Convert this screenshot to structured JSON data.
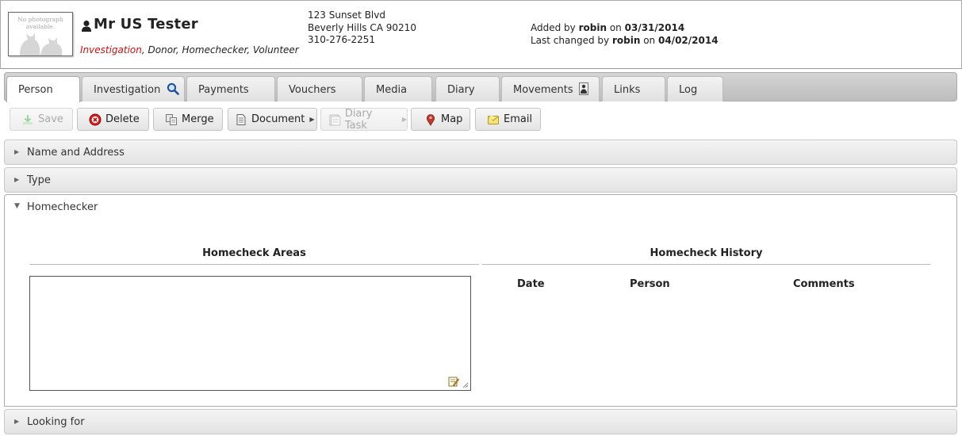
{
  "header": {
    "photo_text": "No photograph available.",
    "name": "Mr US Tester",
    "flags": {
      "warning": "Investigation",
      "rest": ", Donor, Homechecker, Volunteer"
    },
    "address": {
      "line1": "123 Sunset Blvd",
      "line2": "Beverly Hills CA 90210",
      "phone": "310-276-2251"
    },
    "audit": {
      "added_prefix": "Added by",
      "added_by": "robin",
      "added_on_word": "on",
      "added_date": "03/31/2014",
      "changed_prefix": "Last changed by",
      "changed_by": "robin",
      "changed_on_word": "on",
      "changed_date": "04/02/2014"
    }
  },
  "tabs": [
    {
      "label": "Person",
      "active": true
    },
    {
      "label": "Investigation",
      "icon": "magnifier-icon"
    },
    {
      "label": "Payments"
    },
    {
      "label": "Vouchers"
    },
    {
      "label": "Media"
    },
    {
      "label": "Diary"
    },
    {
      "label": "Movements",
      "icon": "movement-icon"
    },
    {
      "label": "Links"
    },
    {
      "label": "Log"
    }
  ],
  "toolbar": {
    "save": "Save",
    "delete": "Delete",
    "merge": "Merge",
    "document": "Document",
    "diary_task": "Diary Task",
    "map": "Map",
    "email": "Email"
  },
  "sections": {
    "name_address": "Name and Address",
    "type": "Type",
    "homechecker": "Homechecker",
    "looking_for": "Looking for"
  },
  "homechecker": {
    "areas_title": "Homecheck Areas",
    "areas_value": "",
    "history_title": "Homecheck History",
    "columns": [
      "Date",
      "Person",
      "Comments"
    ]
  },
  "colors": {
    "warning_flag": "#cc1111",
    "tabbar_bg": "#c8c8c8"
  }
}
